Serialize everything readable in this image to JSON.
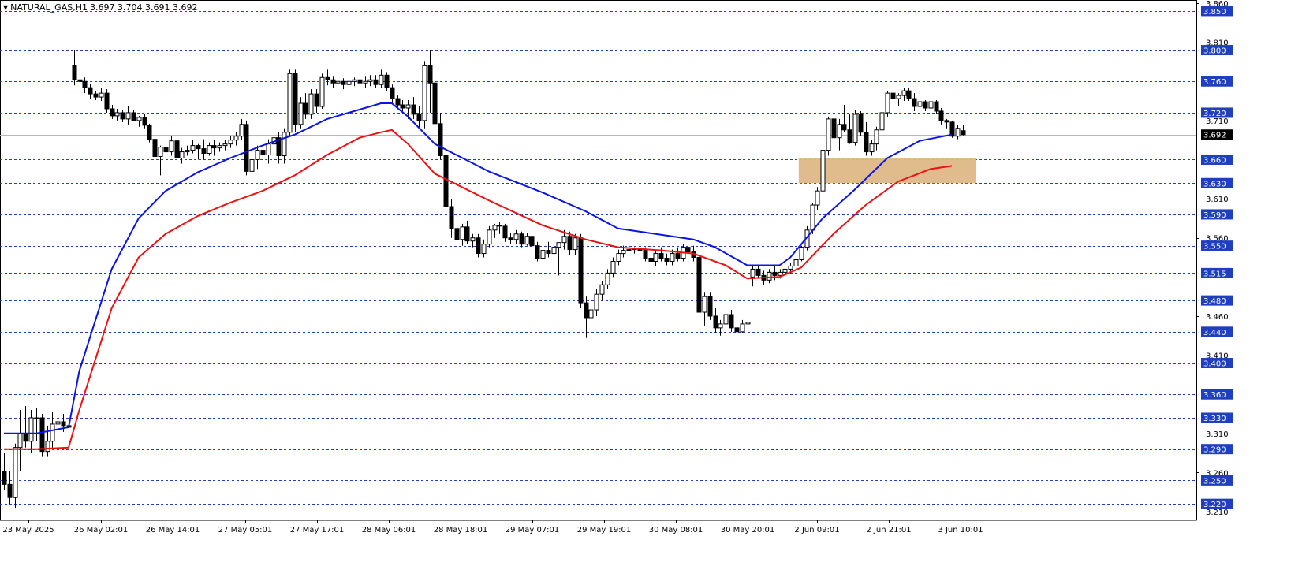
{
  "header": {
    "symbol": "NATURAL_GAS,H1",
    "ohlc": "3.697 3.704 3.691 3.692",
    "menu_glyph": "▼"
  },
  "colors": {
    "background": "#ffffff",
    "grid_level": "#1f3fbf",
    "fast_ma": "#0a14e6",
    "slow_ma": "#ee1111",
    "zone_fill": "#deb887",
    "candle": "#000000",
    "level_label_bg": "#1f3fbf",
    "current_price_bg": "#000000"
  },
  "chart_data": {
    "type": "candlestick",
    "ylim": [
      3.2,
      3.86
    ],
    "current_price": 3.692,
    "level_lines": [
      3.85,
      3.8,
      3.76,
      3.72,
      3.66,
      3.63,
      3.59,
      3.55,
      3.515,
      3.48,
      3.44,
      3.4,
      3.36,
      3.33,
      3.29,
      3.25,
      3.22
    ],
    "axis_ticks": [
      3.86,
      3.81,
      3.71,
      3.61,
      3.56,
      3.46,
      3.41,
      3.31,
      3.26,
      3.21
    ],
    "x_labels": [
      "23 May 2025",
      "26 May 02:01",
      "26 May 14:01",
      "27 May 05:01",
      "27 May 17:01",
      "28 May 06:01",
      "28 May 18:01",
      "29 May 07:01",
      "29 May 19:01",
      "30 May 08:01",
      "30 May 20:01",
      "2 Jun 09:01",
      "2 Jun 21:01",
      "3 Jun 10:01"
    ],
    "zone": {
      "low": 3.63,
      "high": 3.662,
      "start_bar": 148,
      "end_bar": 180
    },
    "candles": [
      [
        3.262,
        3.285,
        3.238,
        3.245
      ],
      [
        3.245,
        3.262,
        3.22,
        3.228
      ],
      [
        3.228,
        3.297,
        3.215,
        3.292
      ],
      [
        3.292,
        3.34,
        3.262,
        3.31
      ],
      [
        3.31,
        3.345,
        3.292,
        3.3
      ],
      [
        3.3,
        3.34,
        3.285,
        3.33
      ],
      [
        3.33,
        3.342,
        3.3,
        3.33
      ],
      [
        3.33,
        3.335,
        3.28,
        3.287
      ],
      [
        3.287,
        3.32,
        3.28,
        3.3
      ],
      [
        3.3,
        3.338,
        3.29,
        3.322
      ],
      [
        3.322,
        3.335,
        3.31,
        3.325
      ],
      [
        3.325,
        3.335,
        3.312,
        3.32
      ],
      [
        3.32,
        3.336,
        3.304,
        3.318
      ],
      [
        3.78,
        3.8,
        3.755,
        3.762
      ],
      [
        3.762,
        3.775,
        3.752,
        3.76
      ],
      [
        3.76,
        3.765,
        3.745,
        3.752
      ],
      [
        3.752,
        3.757,
        3.738,
        3.744
      ],
      [
        3.744,
        3.748,
        3.736,
        3.74
      ],
      [
        3.74,
        3.752,
        3.735,
        3.745
      ],
      [
        3.745,
        3.75,
        3.72,
        3.725
      ],
      [
        3.725,
        3.73,
        3.712,
        3.716
      ],
      [
        3.716,
        3.725,
        3.71,
        3.72
      ],
      [
        3.72,
        3.723,
        3.708,
        3.712
      ],
      [
        3.712,
        3.728,
        3.705,
        3.72
      ],
      [
        3.72,
        3.724,
        3.71,
        3.71
      ],
      [
        3.71,
        3.716,
        3.702,
        3.714
      ],
      [
        3.714,
        3.718,
        3.7,
        3.704
      ],
      [
        3.704,
        3.706,
        3.682,
        3.686
      ],
      [
        3.686,
        3.69,
        3.655,
        3.664
      ],
      [
        3.664,
        3.678,
        3.64,
        3.676
      ],
      [
        3.676,
        3.684,
        3.664,
        3.67
      ],
      [
        3.67,
        3.69,
        3.665,
        3.684
      ],
      [
        3.684,
        3.69,
        3.66,
        3.662
      ],
      [
        3.662,
        3.675,
        3.655,
        3.67
      ],
      [
        3.67,
        3.678,
        3.665,
        3.672
      ],
      [
        3.672,
        3.685,
        3.668,
        3.678
      ],
      [
        3.678,
        3.68,
        3.66,
        3.674
      ],
      [
        3.674,
        3.686,
        3.66,
        3.668
      ],
      [
        3.668,
        3.682,
        3.665,
        3.678
      ],
      [
        3.678,
        3.685,
        3.665,
        3.675
      ],
      [
        3.675,
        3.682,
        3.67,
        3.678
      ],
      [
        3.678,
        3.685,
        3.672,
        3.68
      ],
      [
        3.68,
        3.69,
        3.675,
        3.685
      ],
      [
        3.685,
        3.695,
        3.678,
        3.69
      ],
      [
        3.69,
        3.712,
        3.685,
        3.705
      ],
      [
        3.705,
        3.71,
        3.64,
        3.645
      ],
      [
        3.645,
        3.668,
        3.625,
        3.66
      ],
      [
        3.66,
        3.678,
        3.648,
        3.672
      ],
      [
        3.672,
        3.684,
        3.66,
        3.666
      ],
      [
        3.666,
        3.686,
        3.655,
        3.68
      ],
      [
        3.68,
        3.69,
        3.665,
        3.688
      ],
      [
        3.688,
        3.695,
        3.655,
        3.665
      ],
      [
        3.665,
        3.7,
        3.655,
        3.695
      ],
      [
        3.695,
        3.775,
        3.69,
        3.77
      ],
      [
        3.77,
        3.775,
        3.695,
        3.705
      ],
      [
        3.705,
        3.74,
        3.7,
        3.732
      ],
      [
        3.732,
        3.745,
        3.712,
        3.718
      ],
      [
        3.718,
        3.75,
        3.712,
        3.744
      ],
      [
        3.744,
        3.75,
        3.72,
        3.728
      ],
      [
        3.728,
        3.77,
        3.725,
        3.765
      ],
      [
        3.765,
        3.775,
        3.755,
        3.762
      ],
      [
        3.762,
        3.766,
        3.752,
        3.758
      ],
      [
        3.758,
        3.765,
        3.752,
        3.76
      ],
      [
        3.76,
        3.764,
        3.75,
        3.756
      ],
      [
        3.756,
        3.764,
        3.752,
        3.76
      ],
      [
        3.76,
        3.765,
        3.754,
        3.762
      ],
      [
        3.762,
        3.768,
        3.754,
        3.758
      ],
      [
        3.758,
        3.766,
        3.752,
        3.76
      ],
      [
        3.76,
        3.768,
        3.754,
        3.762
      ],
      [
        3.762,
        3.768,
        3.752,
        3.756
      ],
      [
        3.756,
        3.775,
        3.752,
        3.768
      ],
      [
        3.768,
        3.772,
        3.748,
        3.752
      ],
      [
        3.752,
        3.756,
        3.732,
        3.738
      ],
      [
        3.738,
        3.742,
        3.725,
        3.73
      ],
      [
        3.73,
        3.736,
        3.722,
        3.726
      ],
      [
        3.726,
        3.736,
        3.712,
        3.73
      ],
      [
        3.73,
        3.74,
        3.712,
        3.718
      ],
      [
        3.718,
        3.728,
        3.7,
        3.71
      ],
      [
        3.71,
        3.785,
        3.7,
        3.78
      ],
      [
        3.78,
        3.8,
        3.72,
        3.758
      ],
      [
        3.758,
        3.778,
        3.7,
        3.706
      ],
      [
        3.706,
        3.72,
        3.66,
        3.665
      ],
      [
        3.665,
        3.668,
        3.59,
        3.6
      ],
      [
        3.6,
        3.61,
        3.56,
        3.572
      ],
      [
        3.572,
        3.58,
        3.555,
        3.558
      ],
      [
        3.558,
        3.578,
        3.55,
        3.574
      ],
      [
        3.574,
        3.582,
        3.552,
        3.556
      ],
      [
        3.556,
        3.565,
        3.548,
        3.56
      ],
      [
        3.56,
        3.565,
        3.535,
        3.54
      ],
      [
        3.54,
        3.558,
        3.535,
        3.552
      ],
      [
        3.552,
        3.575,
        3.548,
        3.57
      ],
      [
        3.57,
        3.578,
        3.56,
        3.576
      ],
      [
        3.576,
        3.58,
        3.565,
        3.575
      ],
      [
        3.575,
        3.578,
        3.555,
        3.56
      ],
      [
        3.56,
        3.566,
        3.552,
        3.558
      ],
      [
        3.558,
        3.57,
        3.552,
        3.565
      ],
      [
        3.565,
        3.568,
        3.548,
        3.552
      ],
      [
        3.552,
        3.566,
        3.55,
        3.562
      ],
      [
        3.562,
        3.566,
        3.545,
        3.55
      ],
      [
        3.55,
        3.555,
        3.53,
        3.534
      ],
      [
        3.534,
        3.55,
        3.528,
        3.544
      ],
      [
        3.544,
        3.555,
        3.535,
        3.54
      ],
      [
        3.54,
        3.556,
        3.528,
        3.548
      ],
      [
        3.548,
        3.55,
        3.512,
        3.554
      ],
      [
        3.554,
        3.57,
        3.545,
        3.562
      ],
      [
        3.562,
        3.568,
        3.538,
        3.545
      ],
      [
        3.545,
        3.565,
        3.538,
        3.56
      ],
      [
        3.56,
        3.565,
        3.47,
        3.477
      ],
      [
        3.477,
        3.485,
        3.432,
        3.458
      ],
      [
        3.458,
        3.48,
        3.45,
        3.468
      ],
      [
        3.468,
        3.495,
        3.46,
        3.488
      ],
      [
        3.488,
        3.505,
        3.48,
        3.5
      ],
      [
        3.5,
        3.52,
        3.495,
        3.515
      ],
      [
        3.515,
        3.535,
        3.51,
        3.53
      ],
      [
        3.53,
        3.545,
        3.525,
        3.54
      ],
      [
        3.54,
        3.55,
        3.535,
        3.544
      ],
      [
        3.544,
        3.55,
        3.538,
        3.545
      ],
      [
        3.545,
        3.548,
        3.54,
        3.546
      ],
      [
        3.546,
        3.552,
        3.538,
        3.544
      ],
      [
        3.544,
        3.548,
        3.53,
        3.534
      ],
      [
        3.534,
        3.54,
        3.525,
        3.53
      ],
      [
        3.53,
        3.545,
        3.524,
        3.54
      ],
      [
        3.54,
        3.548,
        3.53,
        3.534
      ],
      [
        3.534,
        3.54,
        3.525,
        3.53
      ],
      [
        3.53,
        3.545,
        3.525,
        3.54
      ],
      [
        3.54,
        3.548,
        3.53,
        3.534
      ],
      [
        3.534,
        3.552,
        3.53,
        3.548
      ],
      [
        3.548,
        3.556,
        3.538,
        3.542
      ],
      [
        3.542,
        3.55,
        3.53,
        3.535
      ],
      [
        3.535,
        3.54,
        3.46,
        3.465
      ],
      [
        3.465,
        3.49,
        3.448,
        3.485
      ],
      [
        3.485,
        3.49,
        3.455,
        3.46
      ],
      [
        3.46,
        3.47,
        3.438,
        3.445
      ],
      [
        3.445,
        3.455,
        3.435,
        3.45
      ],
      [
        3.45,
        3.47,
        3.445,
        3.462
      ],
      [
        3.462,
        3.468,
        3.44,
        3.445
      ],
      [
        3.445,
        3.45,
        3.435,
        3.44
      ],
      [
        3.44,
        3.455,
        3.438,
        3.45
      ],
      [
        3.45,
        3.46,
        3.44,
        3.452
      ],
      [
        3.51,
        3.525,
        3.498,
        3.52
      ],
      [
        3.52,
        3.524,
        3.508,
        3.512
      ],
      [
        3.512,
        3.518,
        3.5,
        3.506
      ],
      [
        3.506,
        3.52,
        3.502,
        3.516
      ],
      [
        3.516,
        3.524,
        3.506,
        3.512
      ],
      [
        3.512,
        3.52,
        3.508,
        3.516
      ],
      [
        3.516,
        3.522,
        3.51,
        3.52
      ],
      [
        3.52,
        3.528,
        3.514,
        3.524
      ],
      [
        3.524,
        3.534,
        3.52,
        3.532
      ],
      [
        3.532,
        3.55,
        3.53,
        3.548
      ],
      [
        3.548,
        3.575,
        3.544,
        3.57
      ],
      [
        3.57,
        3.605,
        3.565,
        3.602
      ],
      [
        3.602,
        3.625,
        3.595,
        3.62
      ],
      [
        3.62,
        3.675,
        3.61,
        3.672
      ],
      [
        3.672,
        3.715,
        3.665,
        3.712
      ],
      [
        3.712,
        3.72,
        3.65,
        3.688
      ],
      [
        3.688,
        3.712,
        3.672,
        3.705
      ],
      [
        3.705,
        3.73,
        3.695,
        3.698
      ],
      [
        3.698,
        3.718,
        3.68,
        3.682
      ],
      [
        3.682,
        3.724,
        3.678,
        3.718
      ],
      [
        3.718,
        3.722,
        3.69,
        3.695
      ],
      [
        3.695,
        3.708,
        3.665,
        3.67
      ],
      [
        3.67,
        3.685,
        3.665,
        3.68
      ],
      [
        3.68,
        3.702,
        3.672,
        3.698
      ],
      [
        3.698,
        3.722,
        3.692,
        3.72
      ],
      [
        3.72,
        3.748,
        3.715,
        3.745
      ],
      [
        3.745,
        3.75,
        3.732,
        3.738
      ],
      [
        3.738,
        3.745,
        3.728,
        3.742
      ],
      [
        3.742,
        3.752,
        3.735,
        3.748
      ],
      [
        3.748,
        3.752,
        3.735,
        3.738
      ],
      [
        3.738,
        3.745,
        3.722,
        3.728
      ],
      [
        3.728,
        3.738,
        3.72,
        3.734
      ],
      [
        3.734,
        3.736,
        3.722,
        3.726
      ],
      [
        3.726,
        3.738,
        3.72,
        3.734
      ],
      [
        3.734,
        3.736,
        3.718,
        3.722
      ],
      [
        3.722,
        3.726,
        3.705,
        3.71
      ],
      [
        3.71,
        3.712,
        3.7,
        3.708
      ],
      [
        3.708,
        3.71,
        3.688,
        3.69
      ],
      [
        3.69,
        3.704,
        3.686,
        3.7
      ],
      [
        3.697,
        3.704,
        3.691,
        3.692
      ]
    ],
    "fast_ma": [
      [
        0,
        3.31
      ],
      [
        6,
        3.31
      ],
      [
        12,
        3.318
      ],
      [
        14,
        3.39
      ],
      [
        20,
        3.52
      ],
      [
        25,
        3.585
      ],
      [
        30,
        3.62
      ],
      [
        36,
        3.644
      ],
      [
        42,
        3.662
      ],
      [
        48,
        3.678
      ],
      [
        54,
        3.692
      ],
      [
        60,
        3.712
      ],
      [
        66,
        3.724
      ],
      [
        70,
        3.732
      ],
      [
        72,
        3.732
      ],
      [
        75,
        3.715
      ],
      [
        80,
        3.68
      ],
      [
        90,
        3.645
      ],
      [
        100,
        3.618
      ],
      [
        108,
        3.594
      ],
      [
        114,
        3.572
      ],
      [
        122,
        3.564
      ],
      [
        128,
        3.558
      ],
      [
        132,
        3.548
      ],
      [
        138,
        3.525
      ],
      [
        144,
        3.525
      ],
      [
        146,
        3.535
      ],
      [
        152,
        3.585
      ],
      [
        158,
        3.622
      ],
      [
        164,
        3.662
      ],
      [
        170,
        3.684
      ],
      [
        176,
        3.692
      ]
    ],
    "slow_ma": [
      [
        0,
        3.29
      ],
      [
        6,
        3.29
      ],
      [
        12,
        3.292
      ],
      [
        14,
        3.34
      ],
      [
        20,
        3.47
      ],
      [
        25,
        3.535
      ],
      [
        30,
        3.565
      ],
      [
        36,
        3.588
      ],
      [
        42,
        3.605
      ],
      [
        48,
        3.62
      ],
      [
        54,
        3.64
      ],
      [
        60,
        3.666
      ],
      [
        66,
        3.688
      ],
      [
        70,
        3.695
      ],
      [
        72,
        3.698
      ],
      [
        75,
        3.68
      ],
      [
        80,
        3.642
      ],
      [
        90,
        3.608
      ],
      [
        100,
        3.576
      ],
      [
        108,
        3.558
      ],
      [
        114,
        3.548
      ],
      [
        122,
        3.544
      ],
      [
        128,
        3.54
      ],
      [
        134,
        3.525
      ],
      [
        138,
        3.508
      ],
      [
        144,
        3.51
      ],
      [
        148,
        3.522
      ],
      [
        154,
        3.565
      ],
      [
        160,
        3.602
      ],
      [
        166,
        3.632
      ],
      [
        172,
        3.648
      ],
      [
        176,
        3.652
      ]
    ]
  }
}
